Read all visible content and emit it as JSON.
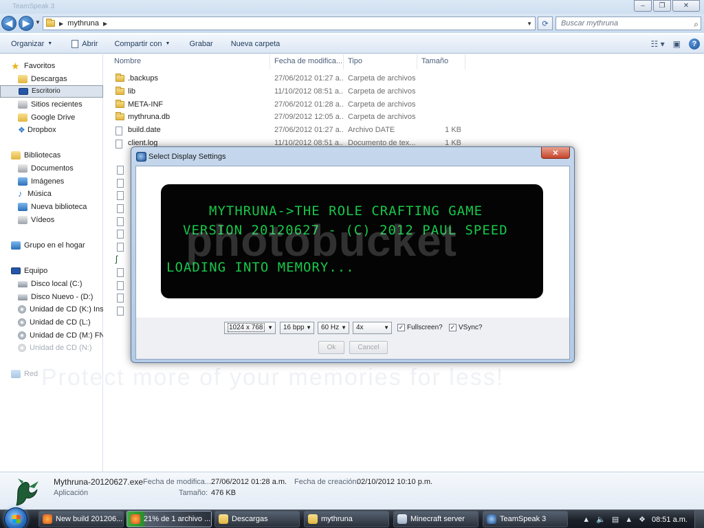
{
  "window": {
    "ghost_title": "TeamSpeak 3",
    "min_label": "–",
    "max_label": "❐",
    "close_label": "✕"
  },
  "address": {
    "path": "mythruna",
    "search_placeholder": "Buscar mythruna"
  },
  "toolbar": {
    "organize": "Organizar",
    "open": "Abrir",
    "share": "Compartir con",
    "burn": "Grabar",
    "new_folder": "Nueva carpeta"
  },
  "sidebar": {
    "items": [
      {
        "label": "Favoritos"
      },
      {
        "label": "Descargas"
      },
      {
        "label": "Escritorio"
      },
      {
        "label": "Sitios recientes"
      },
      {
        "label": "Google Drive"
      },
      {
        "label": "Dropbox"
      },
      {
        "label": "Bibliotecas"
      },
      {
        "label": "Documentos"
      },
      {
        "label": "Imágenes"
      },
      {
        "label": "Música"
      },
      {
        "label": "Nueva biblioteca"
      },
      {
        "label": "Vídeos"
      },
      {
        "label": "Grupo en el hogar"
      },
      {
        "label": "Equipo"
      },
      {
        "label": "Disco local (C:)"
      },
      {
        "label": "Disco Nuevo -  (D:)"
      },
      {
        "label": "Unidad de CD (K:) Inst"
      },
      {
        "label": "Unidad de CD (L:)"
      },
      {
        "label": "Unidad de CD (M:) FN"
      },
      {
        "label": "Unidad de CD (N:)"
      },
      {
        "label": "Red"
      }
    ]
  },
  "columns": {
    "name": "Nombre",
    "date": "Fecha de modifica...",
    "type": "Tipo",
    "size": "Tamaño"
  },
  "files": [
    {
      "name": ".backups",
      "date": "27/06/2012 01:27 a...",
      "type": "Carpeta de archivos",
      "size": ""
    },
    {
      "name": "lib",
      "date": "11/10/2012 08:51 a...",
      "type": "Carpeta de archivos",
      "size": ""
    },
    {
      "name": "META-INF",
      "date": "27/06/2012 01:28 a...",
      "type": "Carpeta de archivos",
      "size": ""
    },
    {
      "name": "mythruna.db",
      "date": "27/09/2012 12:05 a...",
      "type": "Carpeta de archivos",
      "size": ""
    },
    {
      "name": "build.date",
      "date": "27/06/2012 01:27 a...",
      "type": "Archivo DATE",
      "size": "1 KB"
    },
    {
      "name": "client.log",
      "date": "11/10/2012 08:51 a...",
      "type": "Documento de tex...",
      "size": "1 KB"
    }
  ],
  "dialog": {
    "title": "Select Display Settings",
    "close_label": "✕",
    "screen_line1": "MYTHRUNA->THE ROLE CRAFTING GAME",
    "screen_line2": "VERSION 20120627 - (C) 2012 PAUL SPEED",
    "screen_line3": "LOADING INTO MEMORY...",
    "resolution": "1024 x 768",
    "depth": "16 bpp",
    "refresh": "60 Hz",
    "aa": "4x",
    "fullscreen_label": "Fullscreen?",
    "vsync_label": "VSync?",
    "ok_label": "Ok",
    "cancel_label": "Cancel"
  },
  "details": {
    "filename": "Mythruna-20120627.exe",
    "kind": "Aplicación",
    "modified_label": "Fecha de modifica...",
    "modified_value": "27/06/2012 01:28 a.m.",
    "created_label": "Fecha de creación:",
    "created_value": "02/10/2012 10:10 p.m.",
    "size_label": "Tamaño:",
    "size_value": "476 KB"
  },
  "taskbar": {
    "tasks": [
      {
        "label": "New build 201206..."
      },
      {
        "label": "21% de 1 archivo ..."
      },
      {
        "label": "Descargas"
      },
      {
        "label": "mythruna"
      },
      {
        "label": "Minecraft server"
      },
      {
        "label": "TeamSpeak 3"
      }
    ],
    "clock": "08:51 a.m."
  },
  "watermark": {
    "brand": "photobucket",
    "tagline": "Protect more of your memories for less!"
  }
}
